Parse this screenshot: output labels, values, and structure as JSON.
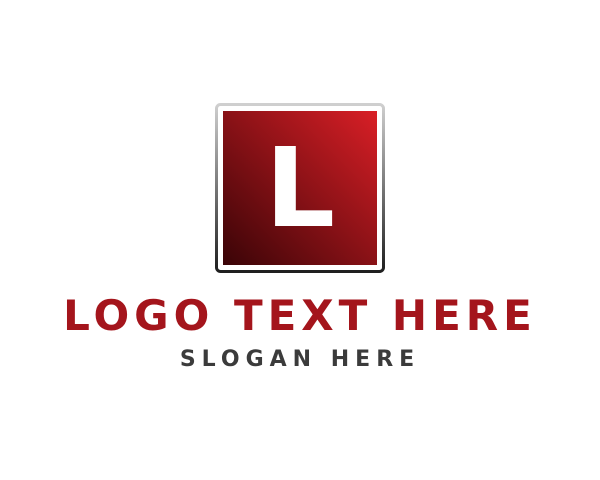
{
  "logo": {
    "initial": "L",
    "title": "LOGO TEXT HERE",
    "slogan": "SLOGAN HERE"
  },
  "colors": {
    "background": "#ffffff",
    "square_gradient_light": "#d91f26",
    "square_gradient_dark": "#3a0407",
    "frame_light": "#cfcfcf",
    "frame_dark": "#1f1f1f",
    "initial": "#ffffff",
    "title": "#a4151c",
    "slogan": "#3b3b3b"
  },
  "icons": {
    "emblem": "square-letter-emblem-icon"
  }
}
